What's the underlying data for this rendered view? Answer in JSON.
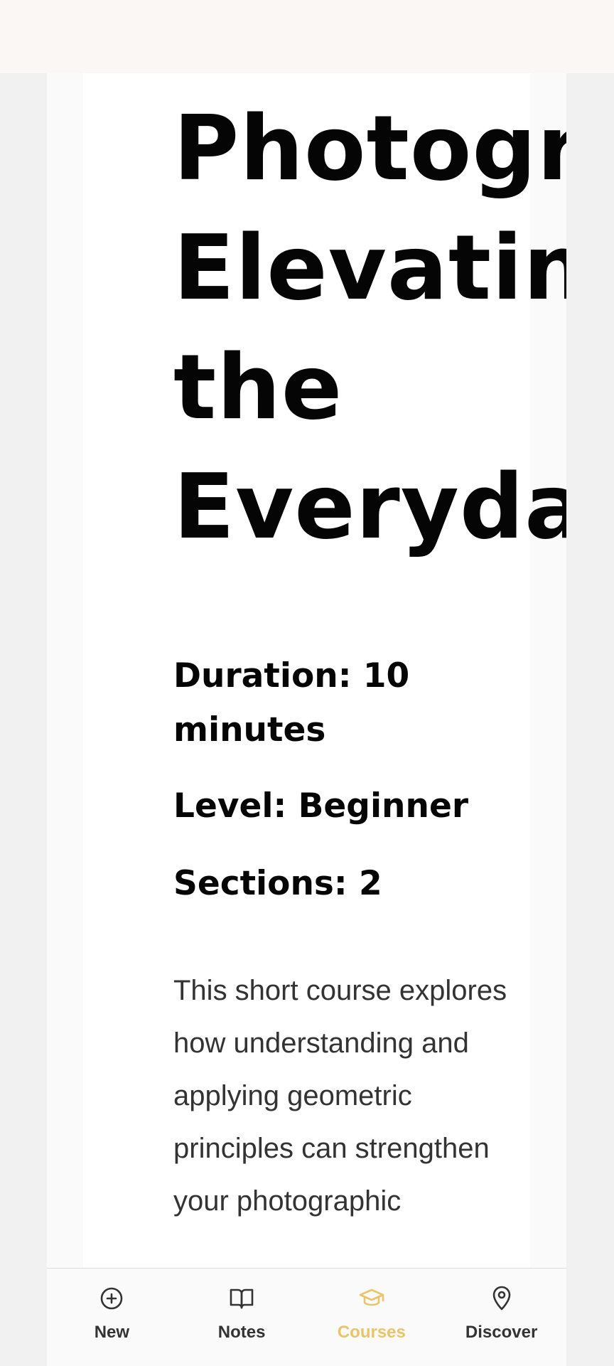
{
  "course": {
    "title": "Photography: Elevating the Everyday",
    "duration": "Duration: 10 minutes",
    "level": "Level: Beginner",
    "sections": "Sections: 2",
    "description": "This short course explores how understanding and applying geometric principles can strengthen your photographic"
  },
  "bottom_nav": {
    "items": [
      {
        "label": "New",
        "icon": "plus-circle-icon",
        "active": false
      },
      {
        "label": "Notes",
        "icon": "open-book-icon",
        "active": false
      },
      {
        "label": "Courses",
        "icon": "graduation-cap-icon",
        "active": true
      },
      {
        "label": "Discover",
        "icon": "map-pin-icon",
        "active": false
      }
    ],
    "active_color": "#e9c46a",
    "inactive_color": "#333333"
  }
}
